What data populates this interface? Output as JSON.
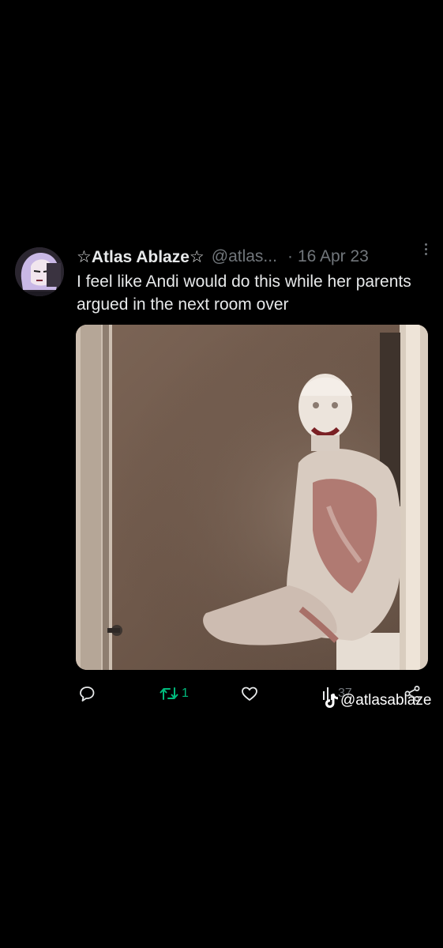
{
  "tweet": {
    "display_name": "☆Atlas Ablaze☆",
    "handle": "@atlas...",
    "separator": "·",
    "date": "16 Apr 23",
    "text": "I feel like Andi would do this while her parents argued in the next room over",
    "media_icon": "photo-of-figure-covered-in-white-substance"
  },
  "actions": {
    "reply_icon": "speech-bubble-icon",
    "retweet_icon": "retweet-icon",
    "retweet_count": "1",
    "like_icon": "heart-icon",
    "views_icon": "bar-chart-icon",
    "views_count": "37",
    "share_icon": "share-icon"
  },
  "watermark": {
    "icon": "tiktok-icon",
    "text": "@atlasablaze"
  },
  "colors": {
    "background": "#000000",
    "text": "#e7e9ea",
    "secondary": "#71767b",
    "retweet_active": "#00ba7c"
  }
}
